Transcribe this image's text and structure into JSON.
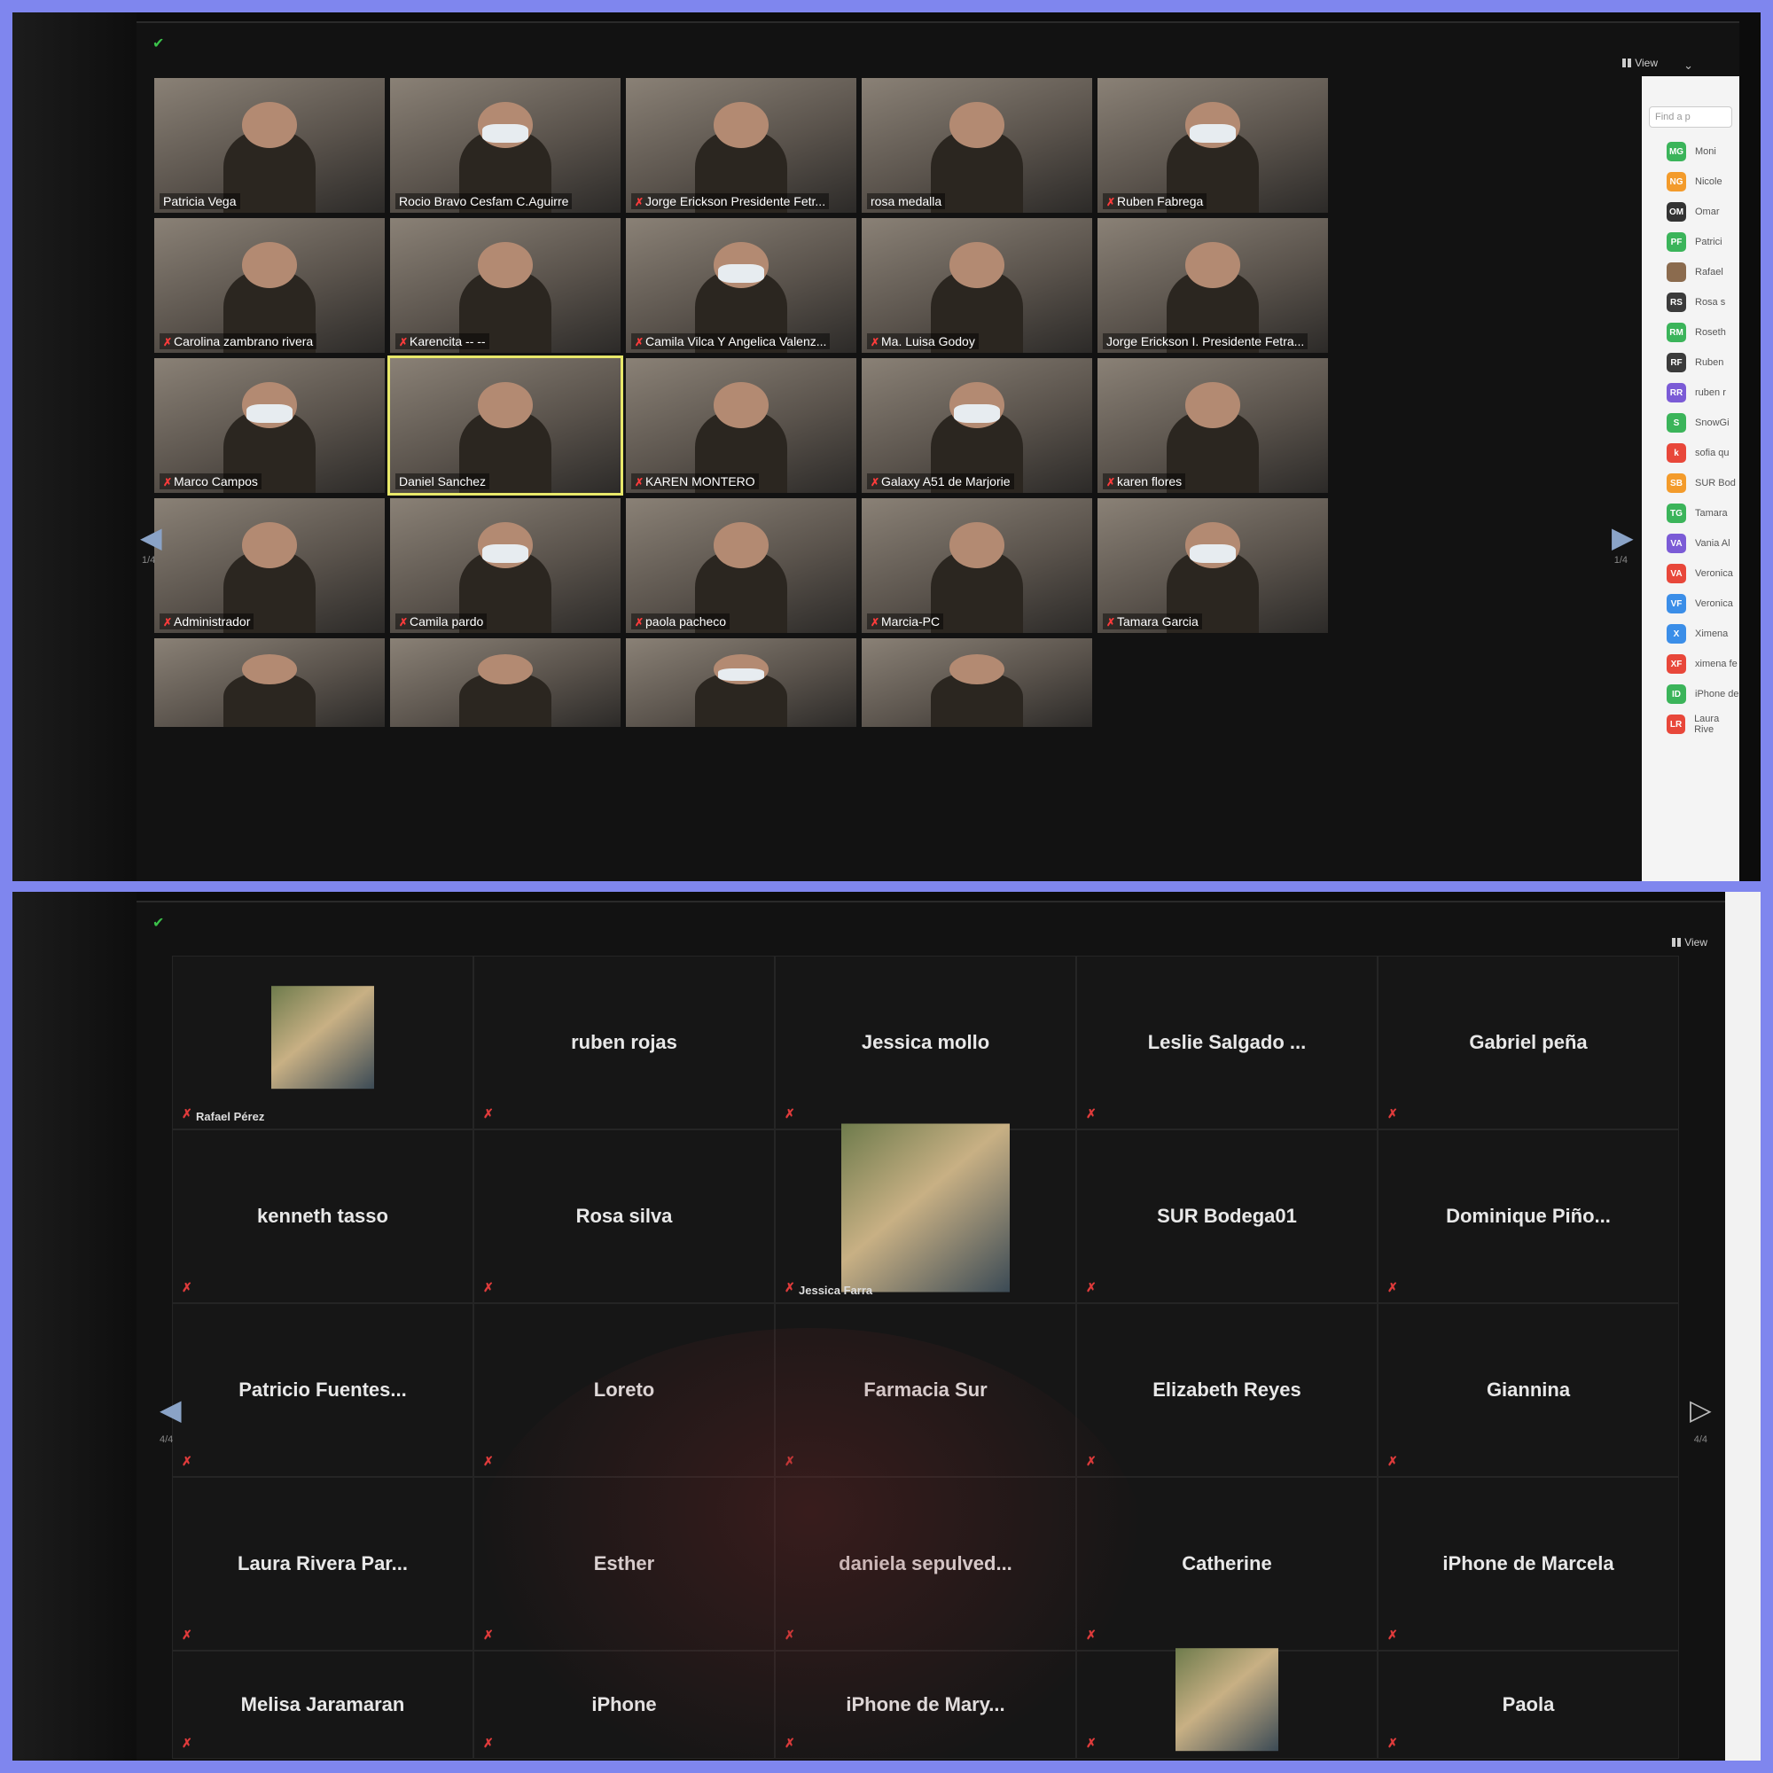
{
  "top_screen": {
    "view_label": "View",
    "page_indicator": "1/4",
    "page_indicator_right": "1/4",
    "sidebar": {
      "search_placeholder": "Find a p",
      "participants": [
        {
          "initials": "MG",
          "name": "Moni",
          "color": "#3bb45a"
        },
        {
          "initials": "NG",
          "name": "Nicole",
          "color": "#f39b2b"
        },
        {
          "initials": "OM",
          "name": "Omar",
          "color": "#333333"
        },
        {
          "initials": "PF",
          "name": "Patrici",
          "color": "#3bb45a"
        },
        {
          "initials": "",
          "name": "Rafael",
          "color": "#8b6b4e"
        },
        {
          "initials": "RS",
          "name": "Rosa s",
          "color": "#3b3b3b"
        },
        {
          "initials": "RM",
          "name": "Roseth",
          "color": "#3bb45a"
        },
        {
          "initials": "RF",
          "name": "Ruben",
          "color": "#3b3b3b"
        },
        {
          "initials": "RR",
          "name": "ruben r",
          "color": "#7b5bd6"
        },
        {
          "initials": "S",
          "name": "SnowGi",
          "color": "#3bb45a"
        },
        {
          "initials": "k",
          "name": "sofia qu",
          "color": "#e8473a"
        },
        {
          "initials": "SB",
          "name": "SUR Bod",
          "color": "#f39b2b"
        },
        {
          "initials": "TG",
          "name": "Tamara",
          "color": "#3bb45a"
        },
        {
          "initials": "VA",
          "name": "Vania Al",
          "color": "#7b5bd6"
        },
        {
          "initials": "VA",
          "name": "Veronica",
          "color": "#e8473a"
        },
        {
          "initials": "VF",
          "name": "Veronica",
          "color": "#3b8ee8"
        },
        {
          "initials": "X",
          "name": "Ximena",
          "color": "#3b8ee8"
        },
        {
          "initials": "XF",
          "name": "ximena fe",
          "color": "#e8473a"
        },
        {
          "initials": "ID",
          "name": "iPhone de",
          "color": "#3bb45a"
        },
        {
          "initials": "LR",
          "name": "Laura Rive",
          "color": "#e8473a"
        }
      ]
    },
    "tiles": [
      {
        "name": "Patricia Vega",
        "muted": false
      },
      {
        "name": "Rocio Bravo Cesfam C.Aguirre",
        "muted": false
      },
      {
        "name": "Jorge Erickson Presidente Fetr...",
        "muted": true
      },
      {
        "name": "rosa medalla",
        "muted": false
      },
      {
        "name": "Ruben Fabrega",
        "muted": true
      },
      {
        "name": "Carolina zambrano rivera",
        "muted": true
      },
      {
        "name": "Karencita -- --",
        "muted": true
      },
      {
        "name": "Camila Vilca Y Angelica Valenz...",
        "muted": true
      },
      {
        "name": "Ma. Luisa Godoy",
        "muted": true
      },
      {
        "name": "Jorge Erickson I. Presidente Fetra...",
        "muted": false
      },
      {
        "name": "Marco Campos",
        "muted": true
      },
      {
        "name": "Daniel Sanchez",
        "muted": false
      },
      {
        "name": "KAREN MONTERO",
        "muted": true
      },
      {
        "name": "Galaxy A51 de Marjorie",
        "muted": true
      },
      {
        "name": "karen flores",
        "muted": true
      },
      {
        "name": "Administrador",
        "muted": true
      },
      {
        "name": "Camila pardo",
        "muted": true
      },
      {
        "name": "paola pacheco",
        "muted": true
      },
      {
        "name": "Marcia-PC",
        "muted": true
      },
      {
        "name": "Tamara Garcia",
        "muted": true
      },
      {
        "name": "",
        "muted": false
      },
      {
        "name": "",
        "muted": false
      },
      {
        "name": "",
        "muted": false
      },
      {
        "name": "",
        "muted": false
      }
    ]
  },
  "bottom_screen": {
    "view_label": "View",
    "page_indicator": "4/4",
    "page_indicator_right": "4/4",
    "tiles": [
      {
        "name": "",
        "small_name": "Rafael Pérez",
        "has_photo": true
      },
      {
        "name": "ruben rojas",
        "small_name": ""
      },
      {
        "name": "Jessica mollo",
        "small_name": ""
      },
      {
        "name": "Leslie Salgado ...",
        "small_name": ""
      },
      {
        "name": "Gabriel peña",
        "small_name": ""
      },
      {
        "name": "kenneth tasso",
        "small_name": ""
      },
      {
        "name": "Rosa silva",
        "small_name": ""
      },
      {
        "name": "",
        "small_name": "Jessica Farra",
        "has_photo": true
      },
      {
        "name": "SUR Bodega01",
        "small_name": ""
      },
      {
        "name": "Dominique  Piño...",
        "small_name": ""
      },
      {
        "name": "Patricio  Fuentes...",
        "small_name": ""
      },
      {
        "name": "Loreto",
        "small_name": ""
      },
      {
        "name": "Farmacia Sur",
        "small_name": ""
      },
      {
        "name": "Elizabeth Reyes",
        "small_name": ""
      },
      {
        "name": "Giannina",
        "small_name": ""
      },
      {
        "name": "Laura Rivera Par...",
        "small_name": ""
      },
      {
        "name": "Esther",
        "small_name": ""
      },
      {
        "name": "daniela sepulved...",
        "small_name": ""
      },
      {
        "name": "Catherine",
        "small_name": ""
      },
      {
        "name": "iPhone de Marcela",
        "small_name": ""
      },
      {
        "name": "Melisa Jaramaran",
        "small_name": ""
      },
      {
        "name": "iPhone",
        "small_name": ""
      },
      {
        "name": "iPhone de Mary...",
        "small_name": ""
      },
      {
        "name": "",
        "small_name": "",
        "has_photo": true
      },
      {
        "name": "Paola",
        "small_name": ""
      }
    ]
  }
}
